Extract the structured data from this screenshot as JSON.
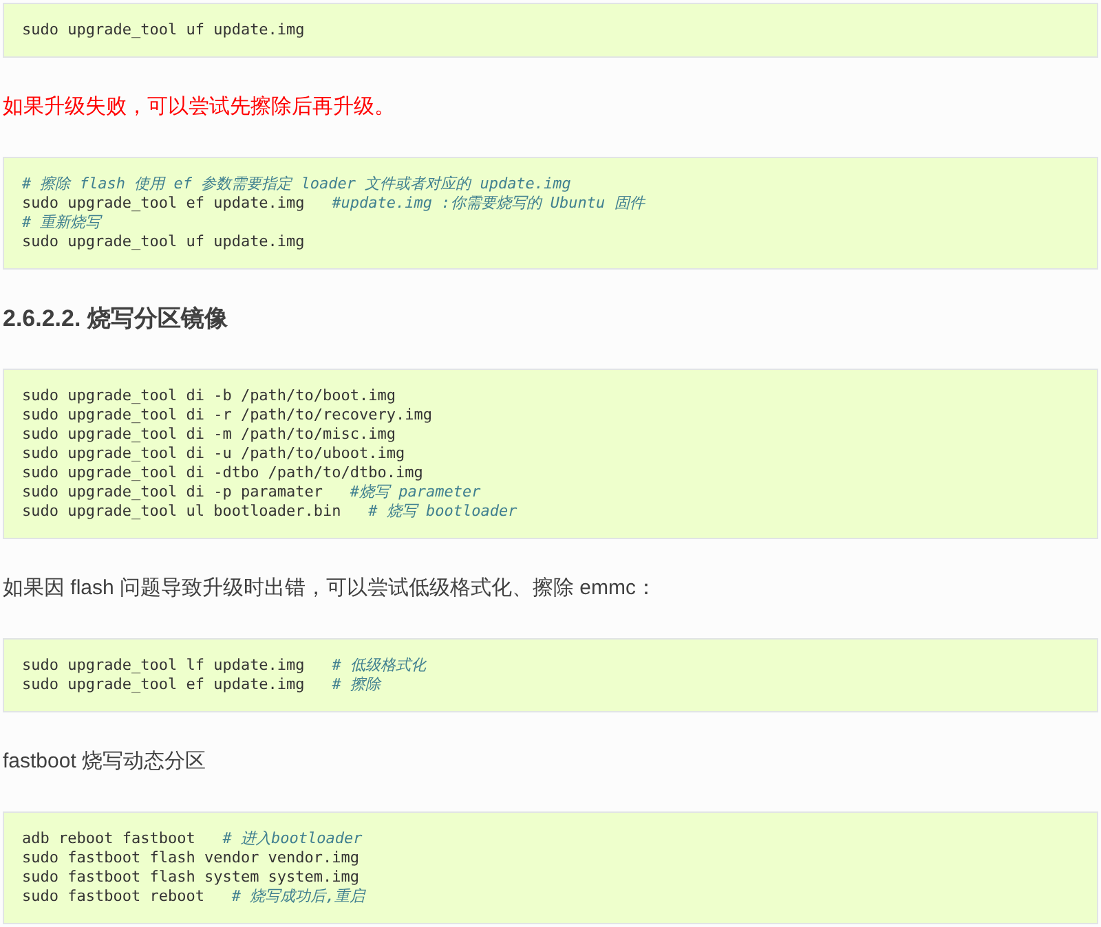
{
  "blocks": [
    {
      "kind": "code",
      "lines": [
        {
          "code": "sudo upgrade_tool uf update.img"
        }
      ]
    },
    {
      "kind": "warning",
      "text": "如果升级失败，可以尝试先擦除后再升级。"
    },
    {
      "kind": "code",
      "lines": [
        {
          "comment": "# 擦除 flash 使用 ef 参数需要指定 loader 文件或者对应的 update.img"
        },
        {
          "code": "sudo upgrade_tool ef update.img",
          "comment": "#update.img :你需要烧写的 Ubuntu 固件"
        },
        {
          "comment": "# 重新烧写"
        },
        {
          "code": "sudo upgrade_tool uf update.img"
        }
      ]
    },
    {
      "kind": "heading",
      "text": "2.6.2.2. 烧写分区镜像"
    },
    {
      "kind": "code",
      "lines": [
        {
          "code": "sudo upgrade_tool di -b /path/to/boot.img"
        },
        {
          "code": "sudo upgrade_tool di -r /path/to/recovery.img"
        },
        {
          "code": "sudo upgrade_tool di -m /path/to/misc.img"
        },
        {
          "code": "sudo upgrade_tool di -u /path/to/uboot.img"
        },
        {
          "code": "sudo upgrade_tool di -dtbo /path/to/dtbo.img"
        },
        {
          "code": "sudo upgrade_tool di -p paramater",
          "comment": "#烧写 parameter"
        },
        {
          "code": "sudo upgrade_tool ul bootloader.bin",
          "comment": "# 烧写 bootloader"
        }
      ]
    },
    {
      "kind": "paragraph",
      "text": "如果因 flash 问题导致升级时出错，可以尝试低级格式化、擦除 emmc："
    },
    {
      "kind": "code",
      "lines": [
        {
          "code": "sudo upgrade_tool lf update.img",
          "comment": "# 低级格式化"
        },
        {
          "code": "sudo upgrade_tool ef update.img",
          "comment": "# 擦除"
        }
      ]
    },
    {
      "kind": "paragraph",
      "text": "fastboot 烧写动态分区"
    },
    {
      "kind": "code",
      "lines": [
        {
          "code": "adb reboot fastboot",
          "comment": "# 进入bootloader"
        },
        {
          "code": "sudo fastboot flash vendor vendor.img"
        },
        {
          "code": "sudo fastboot flash system system.img"
        },
        {
          "code": "sudo fastboot reboot",
          "comment": "# 烧写成功后,重启"
        }
      ]
    }
  ]
}
